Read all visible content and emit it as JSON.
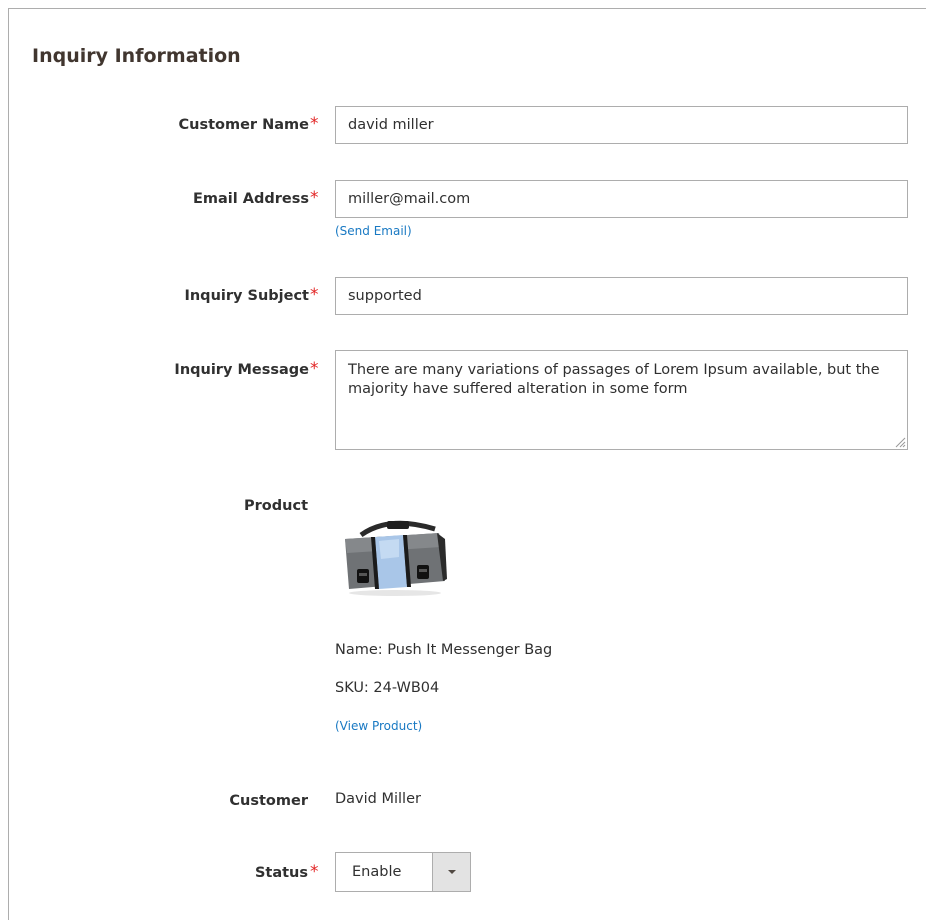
{
  "section": {
    "title": "Inquiry Information"
  },
  "fields": {
    "customer_name": {
      "label": "Customer Name",
      "value": "david miller"
    },
    "email": {
      "label": "Email Address",
      "value": "miller@mail.com",
      "link": "(Send Email)"
    },
    "subject": {
      "label": "Inquiry Subject",
      "value": "supported"
    },
    "message": {
      "label": "Inquiry Message",
      "value": "There are many variations of passages of Lorem Ipsum available, but the majority have suffered alteration in some form"
    }
  },
  "product": {
    "label": "Product",
    "name": "Name: Push It Messenger Bag",
    "sku": "SKU: 24-WB04",
    "link": "(View Product)",
    "image_icon": "messenger-bag-image"
  },
  "customer": {
    "label": "Customer",
    "value": "David Miller"
  },
  "status": {
    "label": "Status",
    "value": "Enable",
    "icon": "chevron-down-icon"
  },
  "required_mark": "*",
  "colors": {
    "link": "#1979c3",
    "required": "#e22626",
    "border": "#adadad"
  }
}
